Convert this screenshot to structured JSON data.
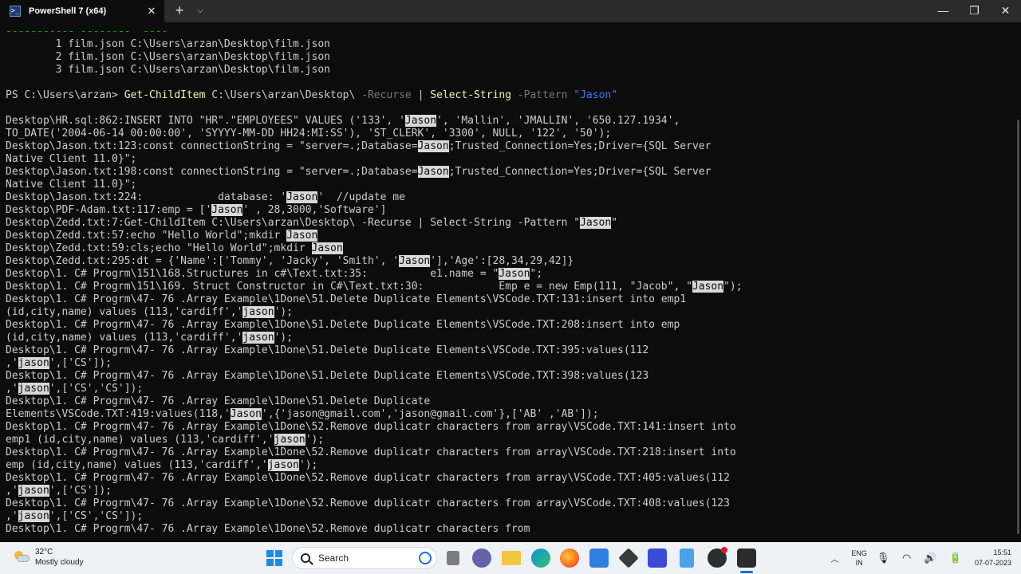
{
  "window": {
    "tab_title": "PowerShell 7 (x64)",
    "tab_icon_glyph": ">_",
    "close_tab_glyph": "✕",
    "new_tab_glyph": "+",
    "dropdown_glyph": "⌵",
    "minimize_glyph": "—",
    "maximize_glyph": "❐",
    "close_glyph": "✕"
  },
  "terminal": {
    "lines": [
      [
        {
          "t": "----------- --------  ----",
          "c": "g"
        }
      ],
      [
        {
          "t": "        1 film.json C:\\Users\\arzan\\Desktop\\film.json"
        }
      ],
      [
        {
          "t": "        2 film.json C:\\Users\\arzan\\Desktop\\film.json"
        }
      ],
      [
        {
          "t": "        3 film.json C:\\Users\\arzan\\Desktop\\film.json"
        }
      ],
      [],
      [
        {
          "t": "PS C:\\Users\\arzan> "
        },
        {
          "t": "Get-ChildItem",
          "c": "y"
        },
        {
          "t": " C:\\Users\\arzan\\Desktop\\ "
        },
        {
          "t": "-Recurse",
          "c": "gr"
        },
        {
          "t": " | "
        },
        {
          "t": "Select-String",
          "c": "y"
        },
        {
          "t": " "
        },
        {
          "t": "-Pattern",
          "c": "gr"
        },
        {
          "t": " "
        },
        {
          "t": "\"Jason\"",
          "c": "b"
        }
      ],
      [],
      [
        {
          "t": "Desktop\\HR.sql:862:INSERT INTO \"HR\".\"EMPLOYEES\" VALUES ('133', '"
        },
        {
          "t": "Jason",
          "c": "hl"
        },
        {
          "t": "', 'Mallin', 'JMALLIN', '650.127.1934',"
        }
      ],
      [
        {
          "t": "TO_DATE('2004-06-14 00:00:00', 'SYYYY-MM-DD HH24:MI:SS'), 'ST_CLERK', '3300', NULL, '122', '50');"
        }
      ],
      [
        {
          "t": "Desktop\\Jason.txt:123:const connectionString = \"server=.;Database="
        },
        {
          "t": "Jason",
          "c": "hl"
        },
        {
          "t": ";Trusted_Connection=Yes;Driver={SQL Server"
        }
      ],
      [
        {
          "t": "Native Client 11.0}\";"
        }
      ],
      [
        {
          "t": "Desktop\\Jason.txt:198:const connectionString = \"server=.;Database="
        },
        {
          "t": "Jason",
          "c": "hl"
        },
        {
          "t": ";Trusted_Connection=Yes;Driver={SQL Server"
        }
      ],
      [
        {
          "t": "Native Client 11.0}\";"
        }
      ],
      [
        {
          "t": "Desktop\\Jason.txt:224:            database: '"
        },
        {
          "t": "Jason",
          "c": "hl"
        },
        {
          "t": "'  //update me"
        }
      ],
      [
        {
          "t": "Desktop\\PDF-Adam.txt:117:emp = ['"
        },
        {
          "t": "Jason",
          "c": "hl"
        },
        {
          "t": "' , 28,3000,'Software']"
        }
      ],
      [
        {
          "t": "Desktop\\Zedd.txt:7:Get-ChildItem C:\\Users\\arzan\\Desktop\\ -Recurse | Select-String -Pattern \""
        },
        {
          "t": "Jason",
          "c": "hl"
        },
        {
          "t": "\""
        }
      ],
      [
        {
          "t": "Desktop\\Zedd.txt:57:echo \"Hello World\";mkdir "
        },
        {
          "t": "Jason",
          "c": "hl"
        }
      ],
      [
        {
          "t": "Desktop\\Zedd.txt:59:cls;echo \"Hello World\";mkdir "
        },
        {
          "t": "Jason",
          "c": "hl"
        }
      ],
      [
        {
          "t": "Desktop\\Zedd.txt:295:dt = {'Name':['Tommy', 'Jacky', 'Smith', '"
        },
        {
          "t": "Jason",
          "c": "hl"
        },
        {
          "t": "'],'Age':[28,34,29,42]}"
        }
      ],
      [
        {
          "t": "Desktop\\1. C# Progrm\\151\\168.Structures in c#\\Text.txt:35:          e1.name = \""
        },
        {
          "t": "Jason",
          "c": "hl"
        },
        {
          "t": "\";"
        }
      ],
      [
        {
          "t": "Desktop\\1. C# Progrm\\151\\169. Struct Constructor in C#\\Text.txt:30:            Emp e = new Emp(111, \"Jacob\", \""
        },
        {
          "t": "Jason",
          "c": "hl"
        },
        {
          "t": "\");"
        }
      ],
      [
        {
          "t": "Desktop\\1. C# Progrm\\47- 76 .Array Example\\1Done\\51.Delete Duplicate Elements\\VSCode.TXT:131:insert into emp1"
        }
      ],
      [
        {
          "t": "(id,city,name) values (113,'cardiff','"
        },
        {
          "t": "jason",
          "c": "hl"
        },
        {
          "t": "');"
        }
      ],
      [
        {
          "t": "Desktop\\1. C# Progrm\\47- 76 .Array Example\\1Done\\51.Delete Duplicate Elements\\VSCode.TXT:208:insert into emp"
        }
      ],
      [
        {
          "t": "(id,city,name) values (113,'cardiff','"
        },
        {
          "t": "jason",
          "c": "hl"
        },
        {
          "t": "');"
        }
      ],
      [
        {
          "t": "Desktop\\1. C# Progrm\\47- 76 .Array Example\\1Done\\51.Delete Duplicate Elements\\VSCode.TXT:395:values(112"
        }
      ],
      [
        {
          "t": ",'"
        },
        {
          "t": "jason",
          "c": "hl"
        },
        {
          "t": "',['CS']);"
        }
      ],
      [
        {
          "t": "Desktop\\1. C# Progrm\\47- 76 .Array Example\\1Done\\51.Delete Duplicate Elements\\VSCode.TXT:398:values(123"
        }
      ],
      [
        {
          "t": ",'"
        },
        {
          "t": "jason",
          "c": "hl"
        },
        {
          "t": "',['CS','CS']);"
        }
      ],
      [
        {
          "t": "Desktop\\1. C# Progrm\\47- 76 .Array Example\\1Done\\51.Delete Duplicate"
        }
      ],
      [
        {
          "t": "Elements\\VSCode.TXT:419:values(118,'"
        },
        {
          "t": "Jason",
          "c": "hl"
        },
        {
          "t": "',{'jason@gmail.com','jason@gmail.com'},['AB' ,'AB']);"
        }
      ],
      [
        {
          "t": "Desktop\\1. C# Progrm\\47- 76 .Array Example\\1Done\\52.Remove duplicatr characters from array\\VSCode.TXT:141:insert into"
        }
      ],
      [
        {
          "t": "emp1 (id,city,name) values (113,'cardiff','"
        },
        {
          "t": "jason",
          "c": "hl"
        },
        {
          "t": "');"
        }
      ],
      [
        {
          "t": "Desktop\\1. C# Progrm\\47- 76 .Array Example\\1Done\\52.Remove duplicatr characters from array\\VSCode.TXT:218:insert into"
        }
      ],
      [
        {
          "t": "emp (id,city,name) values (113,'cardiff','"
        },
        {
          "t": "jason",
          "c": "hl"
        },
        {
          "t": "');"
        }
      ],
      [
        {
          "t": "Desktop\\1. C# Progrm\\47- 76 .Array Example\\1Done\\52.Remove duplicatr characters from array\\VSCode.TXT:405:values(112"
        }
      ],
      [
        {
          "t": ",'"
        },
        {
          "t": "jason",
          "c": "hl"
        },
        {
          "t": "',['CS']);"
        }
      ],
      [
        {
          "t": "Desktop\\1. C# Progrm\\47- 76 .Array Example\\1Done\\52.Remove duplicatr characters from array\\VSCode.TXT:408:values(123"
        }
      ],
      [
        {
          "t": ",'"
        },
        {
          "t": "jason",
          "c": "hl"
        },
        {
          "t": "',['CS','CS']);"
        }
      ],
      [
        {
          "t": "Desktop\\1. C# Progrm\\47- 76 .Array Example\\1Done\\52.Remove duplicatr characters from"
        }
      ]
    ]
  },
  "taskbar": {
    "weather_temp": "32°C",
    "weather_desc": "Mostly cloudy",
    "search_label": "Search",
    "lang_top": "ENG",
    "lang_bottom": "IN",
    "chevron_glyph": "︿",
    "tray_icons_glyphs": "🎙 ◠ 🔊 🔋",
    "time": "15:51",
    "date": "07-07-2023"
  },
  "colors": {
    "terminal_bg": "#0c0c0c",
    "command_yellow": "#f9f1a5",
    "param_gray": "#767676",
    "string_blue": "#3b78ff",
    "header_green": "#13a10e",
    "match_highlight": "#d8d8d8"
  }
}
